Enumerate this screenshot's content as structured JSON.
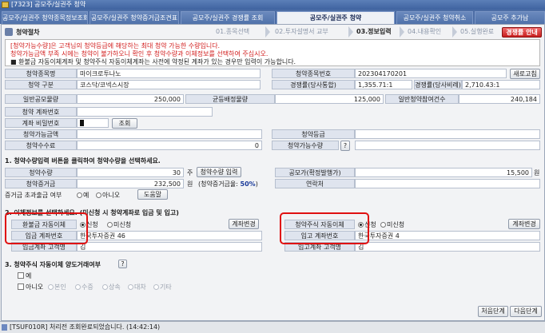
{
  "window": {
    "title": "[7323] 공모주/실권주 청약"
  },
  "tabs": [
    {
      "label": "공모주/실권주 청약종목정보조회"
    },
    {
      "label": "공모주/실권주 청약증거금조견표"
    },
    {
      "label": "공모주/실권주 경쟁률 조회"
    },
    {
      "label": "공모주/실권주 청약"
    },
    {
      "label": "공모주/실권주 청약취소"
    },
    {
      "label": "공모주 추가납"
    }
  ],
  "header": {
    "title": "청약절차"
  },
  "steps": [
    {
      "label": "01.종목선택"
    },
    {
      "label": "02.투자설명서 교부"
    },
    {
      "label": "03.정보입력"
    },
    {
      "label": "04.내용확인"
    },
    {
      "label": "05.실행완료"
    }
  ],
  "buttons": {
    "competition": "경쟁률 안내",
    "refresh": "새로고침",
    "lookup": "조회",
    "apply_qty_input": "청약수량 입력",
    "question": "?",
    "help": "도움말",
    "change_account_1": "계좌변경",
    "change_account_2": "계좌변경",
    "first_step": "처음단계",
    "next_step": "다음단계"
  },
  "notice": {
    "line1": "[청약가능수량]은 고객님의 청약등급에 해당하는 최대 청약 가능한 수량입니다.",
    "line2": "청약가능금액 부족 시에는 청약이 불가하오니 확인 후 청약수량과 이체정보를 선택하여 주십시오.",
    "line3": "■ 환불금 자동이체계좌 및 청약주식 자동이체계좌는 사전에 약정된 계좌가 있는 경우만 입력이 가능합니다."
  },
  "info": {
    "stock_name_label": "청약종목명",
    "stock_name": "마이크로투나노",
    "stock_no_label": "청약종목번호",
    "stock_no": "202304170201",
    "type_label": "청약 구분",
    "type": "코스닥/코넥스시장",
    "rate_label": "경쟁률(당사통합)",
    "rate": "1,355.71:1",
    "rate2_label": "경쟁률(당사비례)",
    "rate2": "2,710.43:1",
    "general_qty_label": "일반공모물량",
    "general_qty": "250,000",
    "equal_qty_label": "균등배정물량",
    "equal_qty": "125,000",
    "general_count_label": "일반청약참여건수",
    "general_count": "240,184"
  },
  "account": {
    "account_label": "청약 계좌번호",
    "pw_label": "계좌 비밀번호",
    "avail_amt_label": "청약가능금액",
    "grade_label": "청약등급",
    "fee_label": "청약수수료",
    "fee": "0",
    "avail_qty_label": "청약가능수량"
  },
  "section1": {
    "title": "1. 청약수량입력 버튼을 클릭하여 청약수량을 선택하세요.",
    "qty_label": "청약수량",
    "qty": "30",
    "qty_unit": "주",
    "offer_price_label": "공모가(확정발행가)",
    "offer_price": "15,500",
    "price_unit": "원",
    "deposit_label": "청약증거금",
    "deposit": "232,500",
    "deposit_unit": "원",
    "deposit_rate_text": "(청약증거금율:",
    "deposit_rate": "50%",
    "deposit_rate_close": ")",
    "contact_label": "연락처",
    "excess_label": "증거금 초과출금 여부",
    "yes": "예",
    "no": "아니오"
  },
  "section2": {
    "title": "2. 이체정보를 선택하세요. (미신청 시 청약계좌로 입금 및 입고)",
    "refund_label": "환불금 자동이체",
    "apply": "신청",
    "not_apply": "미신청",
    "deposit_account_label": "입금 계좌번호",
    "deposit_account": "한국투자증권 46",
    "deposit_owner_label": "입금계좌 고객명",
    "deposit_owner": "김",
    "stock_transfer_label": "청약주식 자동이체",
    "stock_account_label": "입고 계좌번호",
    "stock_account": "한국투자증권 4",
    "stock_owner_label": "입고계좌 고객명",
    "stock_owner": "김"
  },
  "section3": {
    "title": "3. 청약주식 자동이체 양도거래여부",
    "yes": "예",
    "no": "아니오",
    "options": [
      "본인",
      "수증",
      "상속",
      "대차",
      "기타"
    ]
  },
  "status": {
    "text": "[TSUF010R] 처리전 조회완료되었습니다. (14:42:14)"
  }
}
